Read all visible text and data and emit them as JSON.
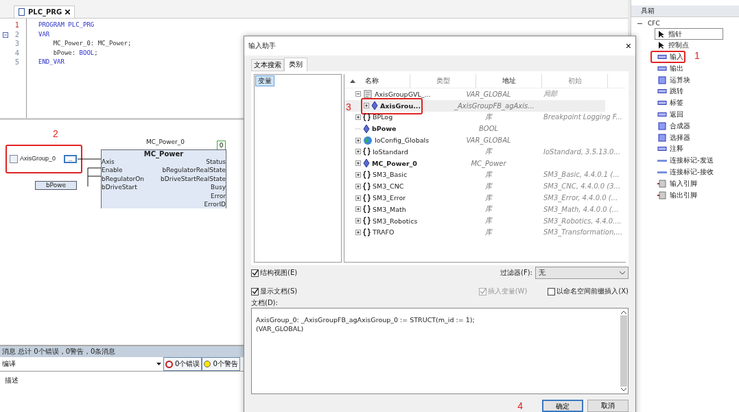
{
  "editor": {
    "tab": "PLC_PRG",
    "lines": [
      {
        "num": "1",
        "current": true,
        "foldable": false,
        "parts": [
          {
            "text": "PROGRAM PLC_PRG",
            "kind": "keyword"
          }
        ]
      },
      {
        "num": "2",
        "current": false,
        "foldable": true,
        "parts": [
          {
            "text": "VAR",
            "kind": "keyword"
          }
        ]
      },
      {
        "num": "3",
        "current": false,
        "foldable": false,
        "parts": [
          {
            "text": "    MC_Power_0: MC_Power;",
            "kind": "plain"
          }
        ]
      },
      {
        "num": "4",
        "current": false,
        "foldable": false,
        "parts": [
          {
            "text": "    bPowe: ",
            "kind": "plain"
          },
          {
            "text": "BOOL",
            "kind": "keyword"
          },
          {
            "text": ";",
            "kind": "plain"
          }
        ]
      },
      {
        "num": "5",
        "current": false,
        "foldable": false,
        "parts": [
          {
            "text": "END_VAR",
            "kind": "keyword"
          }
        ]
      }
    ]
  },
  "cfc": {
    "instance": "MC_Power_0",
    "block": "MC_Power",
    "badge": "0",
    "input_var": "AxisGroup_0",
    "browse": "...",
    "const": "bPowe",
    "inputs": [
      "Axis",
      "Enable",
      "bRegulatorOn",
      "bDriveStart"
    ],
    "outputs": [
      "Status",
      "bRegulatorRealState",
      "bDriveStartRealState",
      "Busy",
      "Error",
      "ErrorID"
    ],
    "marker": "2"
  },
  "messages": {
    "title": "消息 总计 0个错误，0警告，0条消息",
    "source": "编译",
    "errors": "0个错误",
    "warnings": "0个警告",
    "column": "描述"
  },
  "dialog": {
    "title": "输入助手",
    "close": "×",
    "tabs": [
      {
        "label": "文本搜索",
        "selected": false
      },
      {
        "label": "类别",
        "selected": true
      }
    ],
    "categories": [
      {
        "label": "变量",
        "selected": true
      }
    ],
    "columns": [
      "名称",
      "类型",
      "地址",
      "初始"
    ],
    "rows": [
      {
        "name": "AxisGroupGVL_...",
        "type": "VAR_GLOBAL",
        "initial": "局部",
        "kind": "group",
        "expanded": true,
        "bold": false,
        "selected": false,
        "children": [
          {
            "name": "AxisGrou...",
            "type": "_AxisGroupFB_agAxis...",
            "kind": "variable",
            "expanded": false,
            "bold": true,
            "selected": true,
            "marker": "3"
          }
        ]
      },
      {
        "name": "BPLog",
        "type": "库",
        "initial": "Breakpoint Logging F...",
        "kind": "library",
        "expanded": false,
        "bold": false,
        "selected": false
      },
      {
        "name": "bPowe",
        "type": "BOOL",
        "kind": "variable",
        "bold": true,
        "selected": false
      },
      {
        "name": "IoConfig_Globals",
        "type": "VAR_GLOBAL",
        "kind": "global",
        "expanded": false,
        "bold": false,
        "selected": false
      },
      {
        "name": "IoStandard",
        "type": "库",
        "initial": "IoStandard, 3.5.13.0...",
        "kind": "library",
        "expanded": false,
        "bold": false,
        "selected": false
      },
      {
        "name": "MC_Power_0",
        "type": "MC_Power",
        "kind": "variable",
        "expanded": false,
        "bold": true,
        "selected": false
      },
      {
        "name": "SM3_Basic",
        "type": "库",
        "initial": "SM3_Basic, 4.4.0.1 (...",
        "kind": "library",
        "expanded": false,
        "bold": false,
        "selected": false
      },
      {
        "name": "SM3_CNC",
        "type": "库",
        "initial": "SM3_CNC, 4.4.0.0 (3...",
        "kind": "library",
        "expanded": false,
        "bold": false,
        "selected": false
      },
      {
        "name": "SM3_Error",
        "type": "库",
        "initial": "SM3_Error, 4.4.0.0 (...",
        "kind": "library",
        "expanded": false,
        "bold": false,
        "selected": false
      },
      {
        "name": "SM3_Math",
        "type": "库",
        "initial": "SM3_Math, 4.4.0.0 (...",
        "kind": "library",
        "expanded": false,
        "bold": false,
        "selected": false
      },
      {
        "name": "SM3_Robotics",
        "type": "库",
        "initial": "SM3_Robotics, 4.4.0....",
        "kind": "library",
        "expanded": false,
        "bold": false,
        "selected": false
      },
      {
        "name": "TRAFO",
        "type": "库",
        "initial": "SM3_Transformation,...",
        "kind": "library",
        "expanded": false,
        "bold": false,
        "selected": false
      }
    ],
    "structured_view": {
      "label": "结构视图(E)",
      "checked": true
    },
    "filter": {
      "label": "过滤器(F):",
      "value": "无"
    },
    "show_docs": {
      "label": "显示文档(S)",
      "checked": true
    },
    "insert_var": {
      "label": "插入变量(W)",
      "checked": true,
      "disabled": true
    },
    "namespace": {
      "label": "以命名空间前缀插入(X)",
      "checked": false
    },
    "doc_label": "文档(D):",
    "doc_lines": [
      "AxisGroup_0: _AxisGroupFB_agAxisGroup_0 := STRUCT(m_id := 1);",
      "(VAR_GLOBAL)"
    ],
    "ok": "确定",
    "cancel": "取消",
    "marker": "4"
  },
  "toolbox": {
    "title": "具箱",
    "group": "CFC",
    "items": [
      {
        "label": "指针",
        "kind": "pointer",
        "selected": true
      },
      {
        "label": "控制点",
        "kind": "pointer",
        "selected": false
      },
      {
        "label": "输入",
        "kind": "pin",
        "selected": false,
        "marker": "1"
      },
      {
        "label": "输出",
        "kind": "pin",
        "selected": false
      },
      {
        "label": "运算块",
        "kind": "block",
        "selected": false
      },
      {
        "label": "跳转",
        "kind": "pin",
        "selected": false
      },
      {
        "label": "标签",
        "kind": "pin",
        "selected": false
      },
      {
        "label": "返回",
        "kind": "pin",
        "selected": false
      },
      {
        "label": "合成器",
        "kind": "block",
        "selected": false
      },
      {
        "label": "选择器",
        "kind": "block",
        "selected": false
      },
      {
        "label": "注释",
        "kind": "pin",
        "selected": false
      },
      {
        "label": "连接标记-发送",
        "kind": "line",
        "selected": false
      },
      {
        "label": "连接标记-接收",
        "kind": "line",
        "selected": false
      },
      {
        "label": "输入引脚",
        "kind": "grey",
        "selected": false
      },
      {
        "label": "输出引脚",
        "kind": "grey",
        "selected": false
      }
    ]
  }
}
